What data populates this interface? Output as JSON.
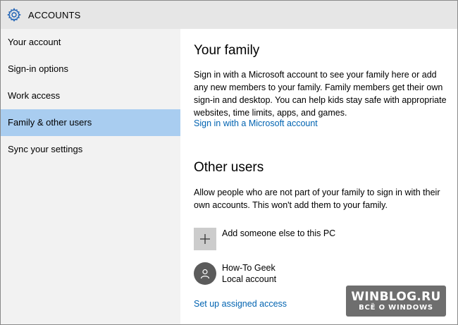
{
  "window": {
    "title": "ACCOUNTS",
    "icon": "gear-icon"
  },
  "sidebar": {
    "items": [
      {
        "label": "Your account",
        "selected": false
      },
      {
        "label": "Sign-in options",
        "selected": false
      },
      {
        "label": "Work access",
        "selected": false
      },
      {
        "label": "Family & other users",
        "selected": true
      },
      {
        "label": "Sync your settings",
        "selected": false
      }
    ],
    "selected_color": "#a9cdf0"
  },
  "family": {
    "heading": "Your family",
    "description": "Sign in with a Microsoft account to see your family here or add any new members to your family. Family members get their own sign-in and desktop. You can help kids stay safe with appropriate websites, time limits, apps, and games.",
    "link": "Sign in with a Microsoft account"
  },
  "other_users": {
    "heading": "Other users",
    "description": "Allow people who are not part of your family to sign in with their own accounts. This won't add them to your family.",
    "add_label": "Add someone else to this PC",
    "add_icon": "plus-icon",
    "user": {
      "name": "How-To Geek",
      "type": "Local account",
      "icon": "user-icon"
    },
    "assigned_access_link": "Set up assigned access"
  },
  "watermark": {
    "main": "WINBLOG.RU",
    "sub": "ВСЁ О WINDOWS"
  },
  "colors": {
    "link": "#0063b1",
    "titlebar": "#e6e6e6",
    "sidebar": "#f2f2f2"
  }
}
